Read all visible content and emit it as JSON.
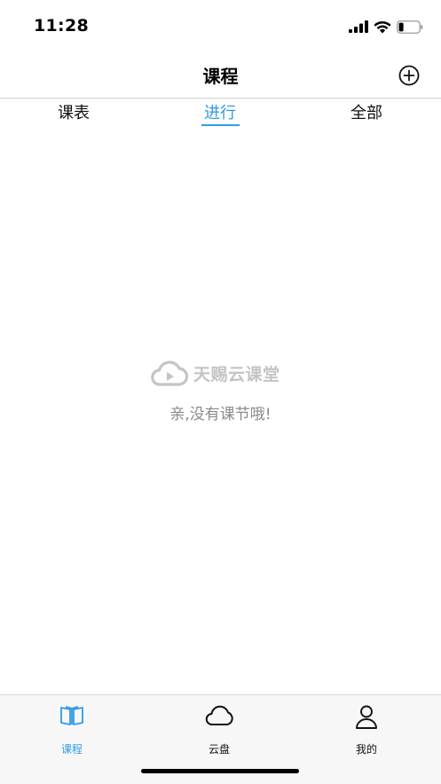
{
  "status_bar": {
    "time": "11:28",
    "icons": [
      "signal-icon",
      "wifi-icon",
      "battery-icon"
    ]
  },
  "nav": {
    "title": "课程",
    "add_icon": "plus-circle-icon"
  },
  "tabs": {
    "items": [
      {
        "label": "课表",
        "active": false
      },
      {
        "label": "进行",
        "active": true
      },
      {
        "label": "全部",
        "active": false
      }
    ]
  },
  "empty_state": {
    "brand_name": "天赐云课堂",
    "brand_icon": "cloud-play-icon",
    "message": "亲,没有课节哦!"
  },
  "tab_bar": {
    "items": [
      {
        "label": "课程",
        "icon": "book-icon",
        "active": true
      },
      {
        "label": "云盘",
        "icon": "cloud-icon",
        "active": false
      },
      {
        "label": "我的",
        "icon": "person-icon",
        "active": false
      }
    ]
  },
  "colors": {
    "accent": "#2f9be6",
    "muted_text": "#8a8a8a",
    "brand_gray": "#c4c4c4"
  }
}
